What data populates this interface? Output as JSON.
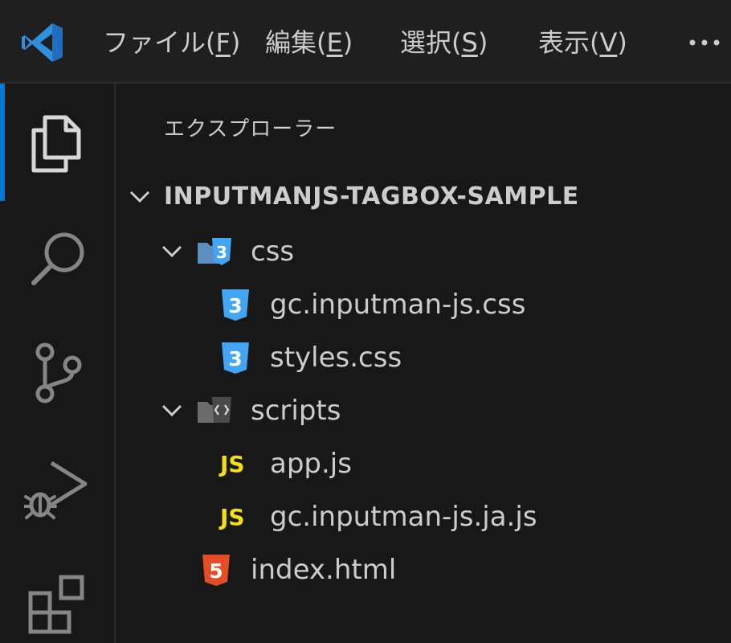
{
  "menu": {
    "items": [
      {
        "text": "ファイル(",
        "mnemonic": "F",
        "close": ")"
      },
      {
        "text": "編集(",
        "mnemonic": "E",
        "close": ")"
      },
      {
        "text": "選択(",
        "mnemonic": "S",
        "close": ")"
      },
      {
        "text": "表示(",
        "mnemonic": "V",
        "close": ")"
      }
    ],
    "more_icon": "ellipsis-icon"
  },
  "activity_bar": {
    "active": "explorer",
    "items": [
      "explorer-icon",
      "search-icon",
      "source-control-icon",
      "run-debug-icon",
      "extensions-icon"
    ]
  },
  "explorer": {
    "title": "エクスプローラー",
    "root": "INPUTMANJS-TAGBOX-SAMPLE",
    "tree": {
      "css_folder": "css",
      "css_file_1": "gc.inputman-js.css",
      "css_file_2": "styles.css",
      "scripts_folder": "scripts",
      "js_file_1": "app.js",
      "js_file_2": "gc.inputman-js.ja.js",
      "html_file": "index.html"
    },
    "js_badge": "JS"
  },
  "colors": {
    "accent": "#0078d4",
    "css_icon": "#42a5f5",
    "js_icon": "#f5de19",
    "html_icon": "#e44d26",
    "text": "#cccccc",
    "background": "#181818"
  }
}
